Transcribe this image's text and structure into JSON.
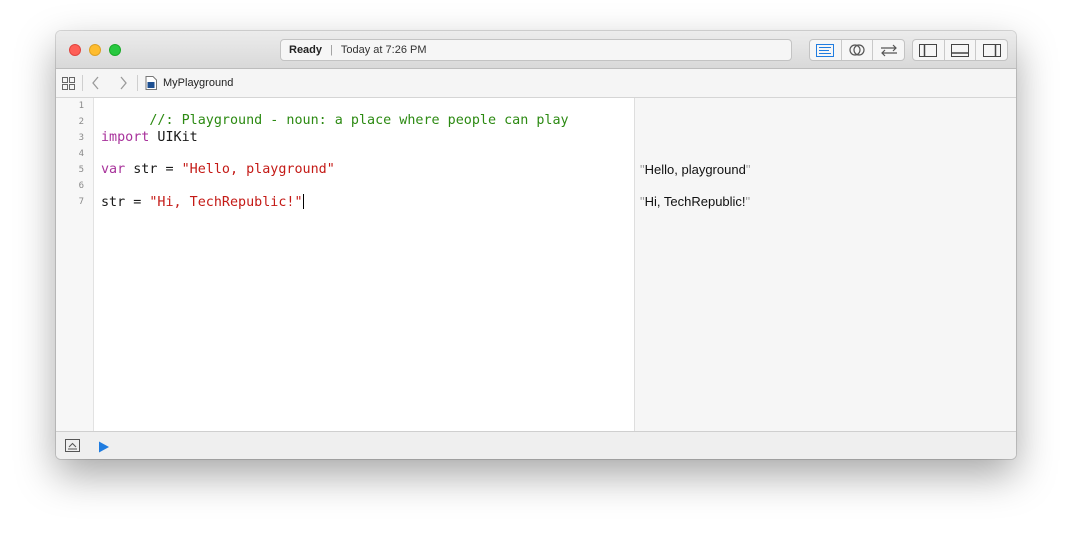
{
  "window": {
    "status": {
      "state": "Ready",
      "timestamp": "Today at 7:26 PM"
    },
    "toolbar_icons": [
      "standard-editor-icon",
      "assistant-editor-icon",
      "version-editor-icon",
      "navigator-toggle-icon",
      "debug-area-toggle-icon",
      "utilities-toggle-icon"
    ]
  },
  "jumpbar": {
    "file_name": "MyPlayground"
  },
  "editor": {
    "line_numbers": [
      "1",
      "2",
      "3",
      "4",
      "5",
      "6",
      "7"
    ],
    "lines": {
      "l1_comment": "//: Playground - noun: a place where people can play",
      "l3_keyword": "import",
      "l3_rest": " UIKit",
      "l5_keyword": "var",
      "l5_mid": " str = ",
      "l5_string": "\"Hello, playground\"",
      "l7_mid": "str = ",
      "l7_string": "\"Hi, TechRepublic!\""
    }
  },
  "results": {
    "r5": "Hello, playground",
    "r7": "Hi, TechRepublic!",
    "quote": "\""
  },
  "colors": {
    "comment": "#2c8a12",
    "keyword": "#a8329b",
    "string": "#c41a16",
    "accent_blue": "#1f7ce0"
  }
}
